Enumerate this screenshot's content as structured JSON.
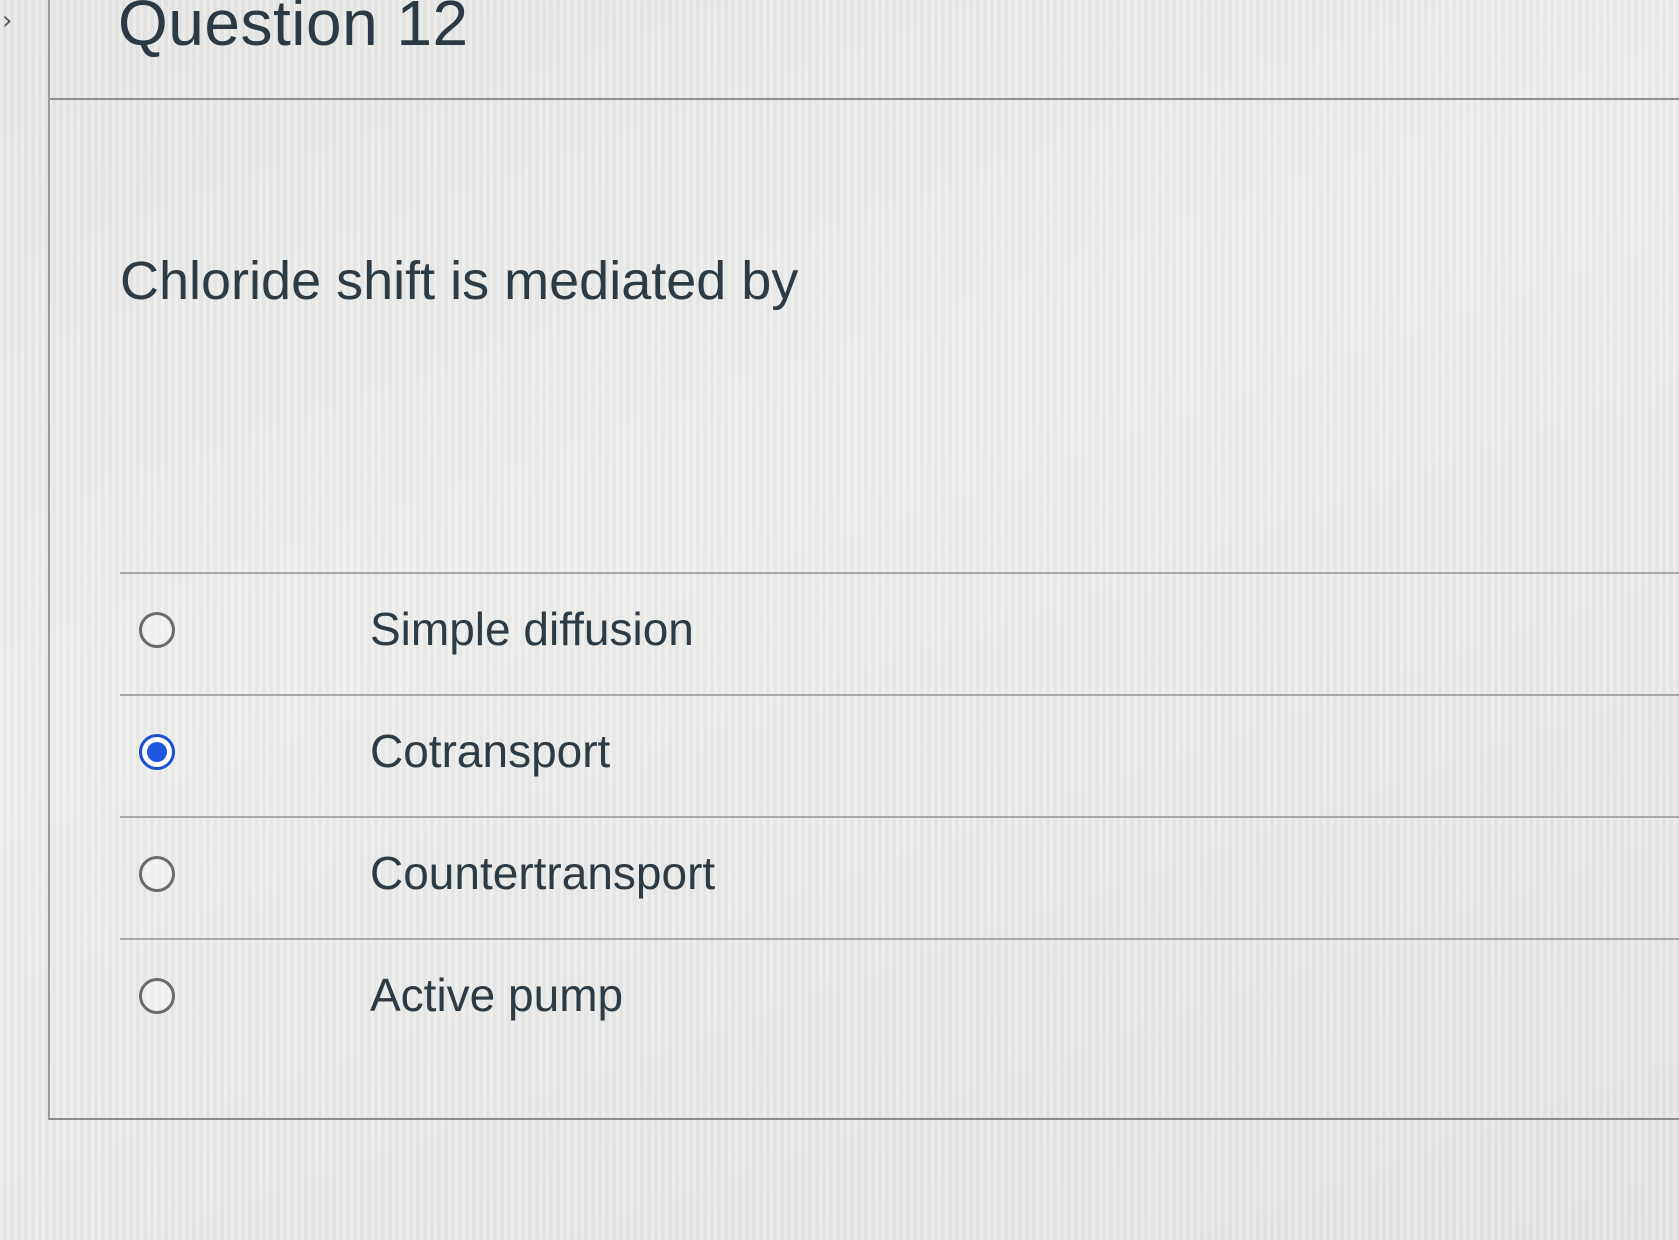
{
  "question": {
    "title": "Question 12",
    "text": "Chloride shift is mediated by"
  },
  "answers": [
    {
      "label": "Simple diffusion",
      "selected": false
    },
    {
      "label": "Cotransport",
      "selected": true
    },
    {
      "label": "Countertransport",
      "selected": false
    },
    {
      "label": "Active pump",
      "selected": false
    }
  ],
  "colors": {
    "selected_radio": "#1f57e0",
    "text": "#2d3b45",
    "background": "#e9e9e7"
  }
}
